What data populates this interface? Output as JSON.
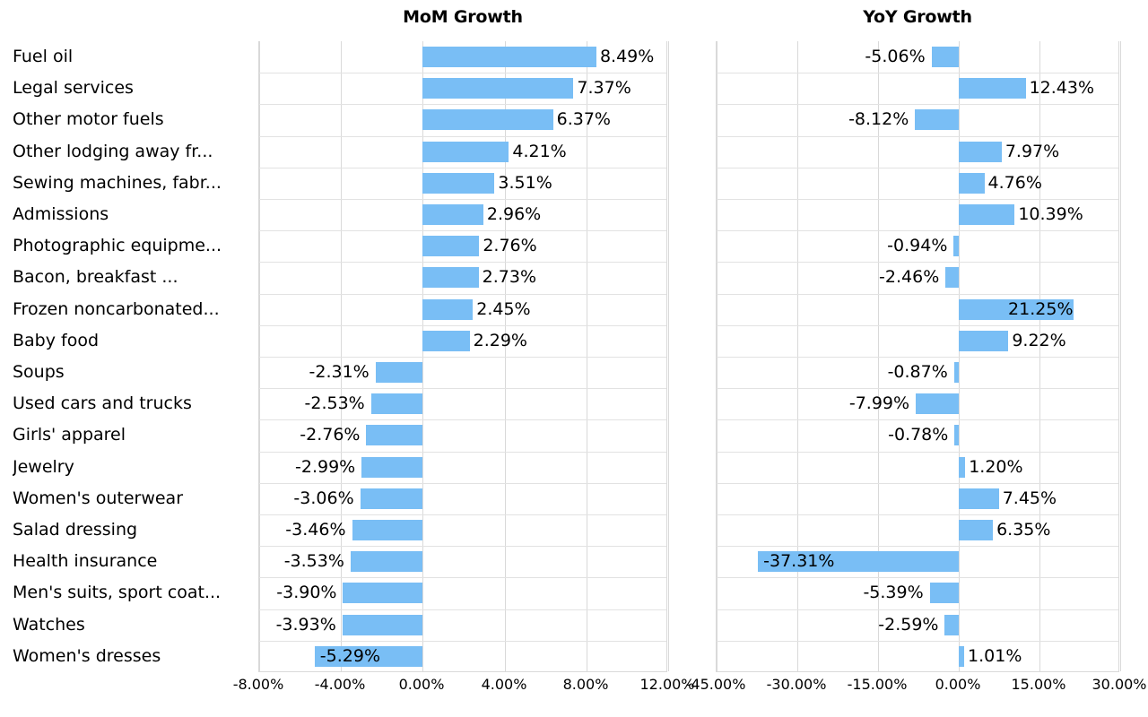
{
  "panels": {
    "mom": {
      "title": "MoM Growth"
    },
    "yoy": {
      "title": "YoY Growth"
    }
  },
  "chart_data": {
    "type": "bar",
    "orientation": "horizontal",
    "title": "",
    "grid": true,
    "legend": "none",
    "categories": [
      "Fuel oil",
      "Legal services",
      "Other motor fuels",
      "Other lodging away fr...",
      "Sewing machines, fabr...",
      "Admissions",
      "Photographic equipme...",
      "Bacon, breakfast ...",
      "Frozen noncarbonated...",
      "Baby food",
      "Soups",
      "Used cars and trucks",
      "Girls' apparel",
      "Jewelry",
      "Women's outerwear",
      "Salad dressing",
      "Health insurance",
      "Men's suits, sport coat...",
      "Watches",
      "Women's dresses"
    ],
    "series": [
      {
        "name": "MoM Growth",
        "xlabel": "",
        "ylabel": "",
        "xlim": [
          -8,
          12
        ],
        "xticks": [
          -8,
          -4,
          0,
          4,
          8,
          12
        ],
        "xtick_labels": [
          "-8.00%",
          "-4.00%",
          "0.00%",
          "4.00%",
          "8.00%",
          "12.00%"
        ],
        "values": [
          8.49,
          7.37,
          6.37,
          4.21,
          3.51,
          2.96,
          2.76,
          2.73,
          2.45,
          2.29,
          -2.31,
          -2.53,
          -2.76,
          -2.99,
          -3.06,
          -3.46,
          -3.53,
          -3.9,
          -3.93,
          -5.29
        ],
        "value_labels": [
          "8.49%",
          "7.37%",
          "6.37%",
          "4.21%",
          "3.51%",
          "2.96%",
          "2.76%",
          "2.73%",
          "2.45%",
          "2.29%",
          "-2.31%",
          "-2.53%",
          "-2.76%",
          "-2.99%",
          "-3.06%",
          "-3.46%",
          "-3.53%",
          "-3.90%",
          "-3.93%",
          "-5.29%"
        ],
        "label_inside": [
          false,
          false,
          false,
          false,
          false,
          false,
          false,
          false,
          false,
          false,
          false,
          false,
          false,
          false,
          false,
          false,
          false,
          false,
          false,
          true
        ],
        "bar_color": "#79bef5"
      },
      {
        "name": "YoY Growth",
        "xlabel": "",
        "ylabel": "",
        "xlim": [
          -45,
          30
        ],
        "xticks": [
          -45,
          -30,
          -15,
          0,
          15,
          30
        ],
        "xtick_labels": [
          "-45.00%",
          "-30.00%",
          "-15.00%",
          "0.00%",
          "15.00%",
          "30.00%"
        ],
        "values": [
          -5.06,
          12.43,
          -8.12,
          7.97,
          4.76,
          10.39,
          -0.94,
          -2.46,
          21.25,
          9.22,
          -0.87,
          -7.99,
          -0.78,
          1.2,
          7.45,
          6.35,
          -37.31,
          -5.39,
          -2.59,
          1.01
        ],
        "value_labels": [
          "-5.06%",
          "12.43%",
          "-8.12%",
          "7.97%",
          "4.76%",
          "10.39%",
          "-0.94%",
          "-2.46%",
          "21.25%",
          "9.22%",
          "-0.87%",
          "-7.99%",
          "-0.78%",
          "1.20%",
          "7.45%",
          "6.35%",
          "-37.31%",
          "-5.39%",
          "-2.59%",
          "1.01%"
        ],
        "label_inside": [
          false,
          false,
          false,
          false,
          false,
          false,
          false,
          false,
          true,
          false,
          false,
          false,
          false,
          false,
          false,
          false,
          true,
          false,
          false,
          false
        ],
        "bar_color": "#79bef5"
      }
    ]
  }
}
